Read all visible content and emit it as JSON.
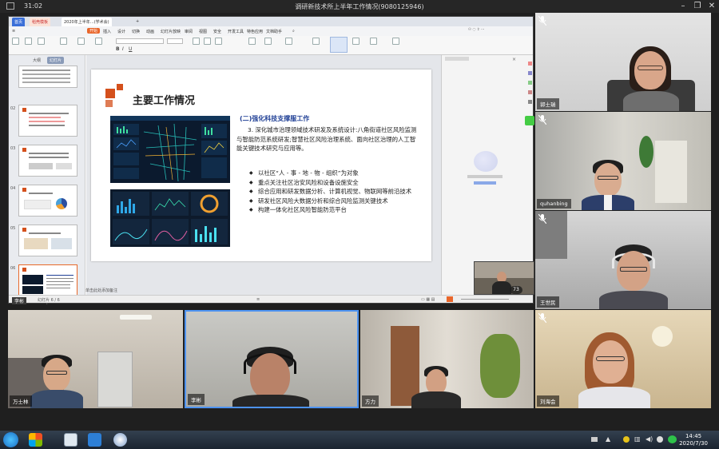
{
  "window": {
    "time": "31:02",
    "title": "调研新技术所上半年工作情况(9080125946)"
  },
  "app": {
    "tabs": [
      "首页",
      "稻壳模板",
      "2020年上半年…(学术会)",
      "+"
    ],
    "menus": [
      "开始",
      "插入",
      "设计",
      "切换",
      "动画",
      "幻灯片放映",
      "审阅",
      "视图",
      "安全",
      "开发工具",
      "特色应用",
      "文档助手"
    ],
    "status_left": "幻灯片 6 / 6",
    "status_note": "单击此处添加备注",
    "zoom": "73"
  },
  "thumbnails": {
    "panel_tabs": [
      "大纲",
      "幻灯片"
    ],
    "numbers": [
      "02",
      "03",
      "04",
      "05",
      "06"
    ]
  },
  "slide": {
    "title": "主要工作情况",
    "section_title": "(二)强化科技支撑服工作",
    "paragraph": "3. 深化城市治理领域技术研发及系统设计:八角街道社区风险监测与智能防范系统研发;智慧社区风险治理系统、面向社区治理的人工智能关键技术研究与应用等。",
    "bullets": [
      "以社区“人 - 事 - 地 - 物 - 组织”为对象",
      "重点关注社区治安风险和设备设施安全",
      "综合应用和研发数据分析、计算机视觉、物联网等前沿技术",
      "研发社区风险大数据分析和综合风险监测关键技术",
      "构建一体化社区风险智能防范平台"
    ]
  },
  "participants": {
    "right": [
      "郭士瑞",
      "quhanbing",
      "王世民",
      "刘海会"
    ],
    "bottom": [
      "万士林",
      "李彬",
      "方力"
    ],
    "presenter_label": "李彬"
  },
  "clock": {
    "time": "14:45",
    "date": "2020/7/30"
  },
  "colors": {
    "accent": "#d4501c",
    "section_blue": "#1f3f95"
  }
}
